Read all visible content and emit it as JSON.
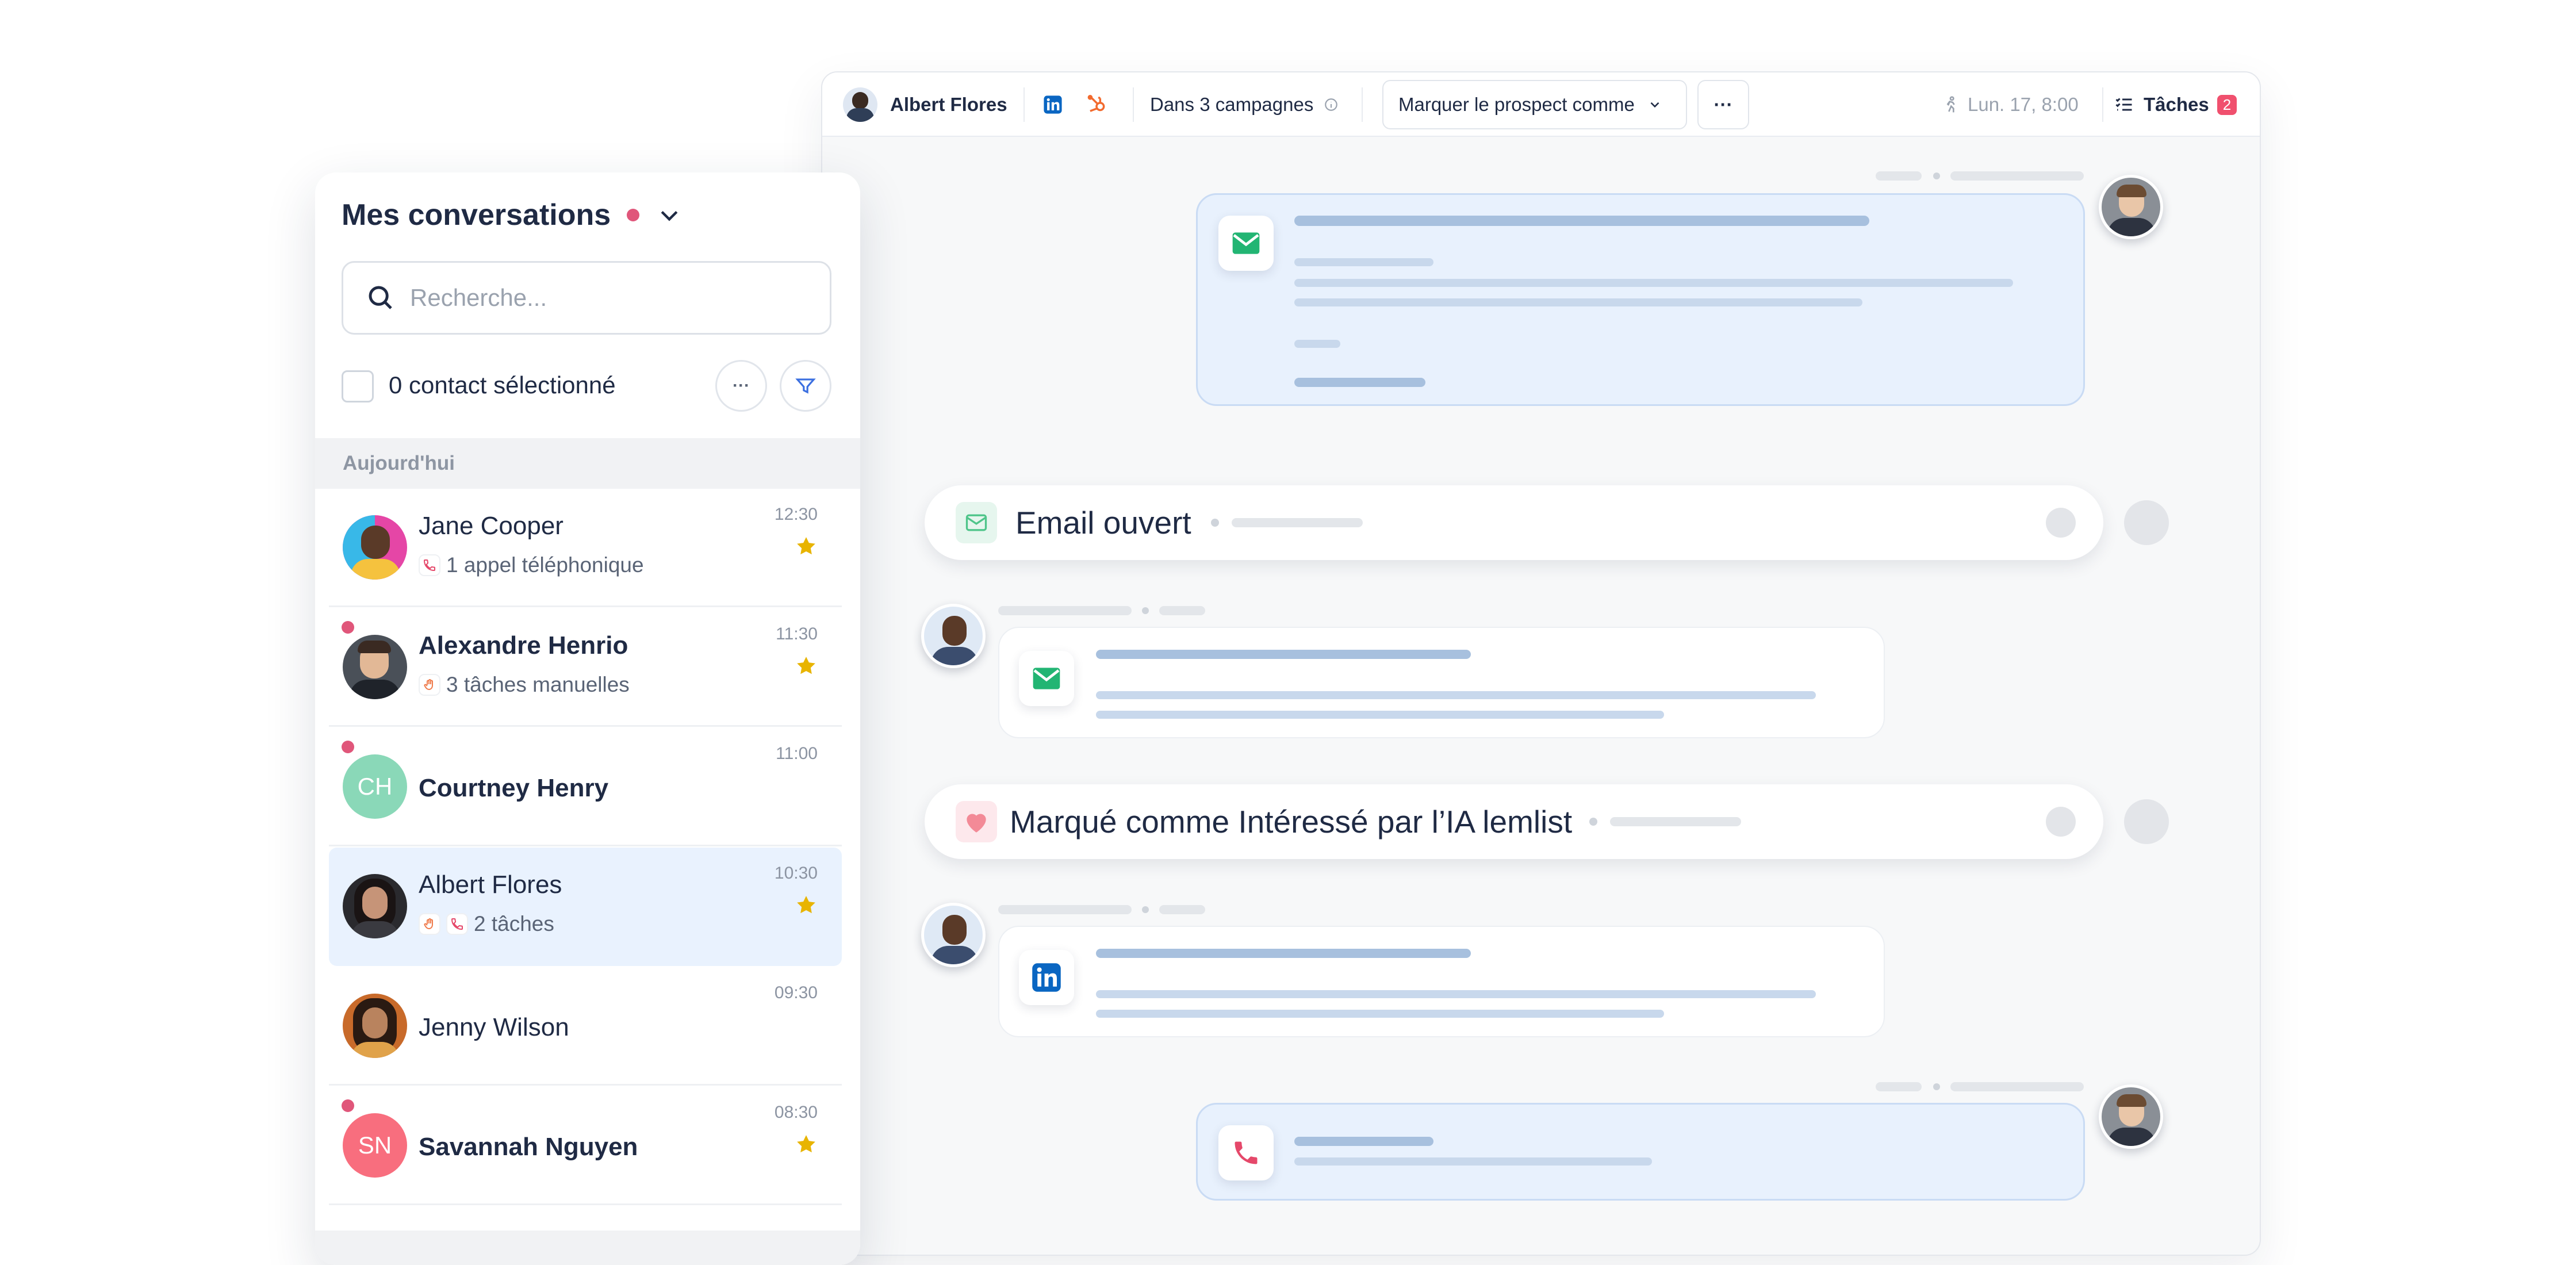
{
  "topbar": {
    "contact_name": "Albert Flores",
    "campaigns": "Dans 3 campagnes",
    "mark_prospect": "Marquer le prospect comme",
    "more": "···",
    "date": "Lun. 17, 8:00",
    "tasks_label": "Tâches",
    "tasks_count": "2"
  },
  "timeline": {
    "email_opened": "Email ouvert",
    "marked_interested": "Marqué comme Intéressé par l’IA lemlist"
  },
  "sidebar": {
    "title": "Mes conversations",
    "search_placeholder": "Recherche...",
    "selected_count": "0 contact sélectionné",
    "more": "···",
    "section_today": "Aujourd'hui",
    "conversations": [
      {
        "name": "Jane Cooper",
        "time": "12:30",
        "sub": "1 appel téléphonique",
        "starred": true,
        "unread": false
      },
      {
        "name": "Alexandre Henrio",
        "time": "11:30",
        "sub": "3 tâches manuelles",
        "starred": true,
        "unread": true
      },
      {
        "name": "Courtney Henry",
        "time": "11:00",
        "sub": "",
        "initials": "CH",
        "starred": false,
        "unread": true
      },
      {
        "name": "Albert Flores",
        "time": "10:30",
        "sub": "2 tâches",
        "starred": true,
        "unread": false,
        "selected": true
      },
      {
        "name": "Jenny Wilson",
        "time": "09:30",
        "sub": "",
        "starred": false,
        "unread": false
      },
      {
        "name": "Savannah Nguyen",
        "time": "08:30",
        "sub": "",
        "initials": "SN",
        "starred": true,
        "unread": true
      }
    ]
  },
  "colors": {
    "accent_red": "#f0506e",
    "star": "#e8b400",
    "email_green": "#22b573",
    "linkedin": "#0a66c2",
    "selected_bg": "#e9f2fe"
  }
}
